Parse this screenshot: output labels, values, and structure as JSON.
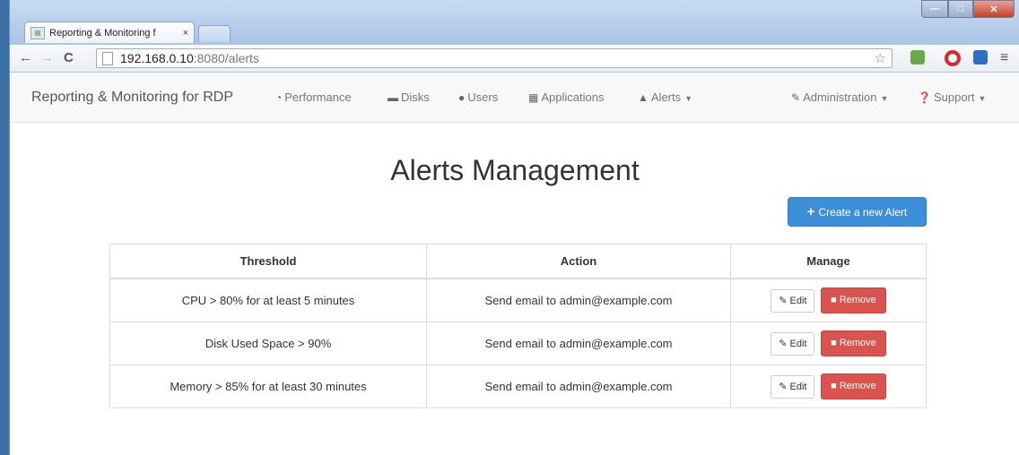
{
  "browser": {
    "tab_title": "Reporting & Monitoring f",
    "tab_close": "×",
    "url_host": "192.168.0.10",
    "url_path": ":8080/alerts",
    "menu_icon": "≡"
  },
  "navbar": {
    "brand": "Reporting & Monitoring for RDP",
    "items": [
      {
        "label": "Performance",
        "icon": "dashboard-icon"
      },
      {
        "label": "Disks",
        "icon": "hdd-icon"
      },
      {
        "label": "Users",
        "icon": "user-icon"
      },
      {
        "label": "Applications",
        "icon": "th-large-icon"
      },
      {
        "label": "Alerts",
        "icon": "bell-icon",
        "dropdown": true
      }
    ],
    "right_items": [
      {
        "label": "Administration",
        "icon": "wrench-icon",
        "dropdown": true
      },
      {
        "label": "Support",
        "icon": "question-icon",
        "dropdown": true
      }
    ]
  },
  "page": {
    "title": "Alerts Management",
    "create_button": "Create a new Alert"
  },
  "table": {
    "headers": [
      "Threshold",
      "Action",
      "Manage"
    ],
    "rows": [
      {
        "threshold": "CPU > 80% for at least 5 minutes",
        "action": "Send email to admin@example.com"
      },
      {
        "threshold": "Disk Used Space > 90%",
        "action": "Send email to admin@example.com"
      },
      {
        "threshold": "Memory > 85% for at least 30 minutes",
        "action": "Send email to admin@example.com"
      }
    ],
    "edit_label": "Edit",
    "remove_label": "Remove"
  },
  "colors": {
    "primary": "#3c8ed8",
    "danger": "#d9534f"
  }
}
